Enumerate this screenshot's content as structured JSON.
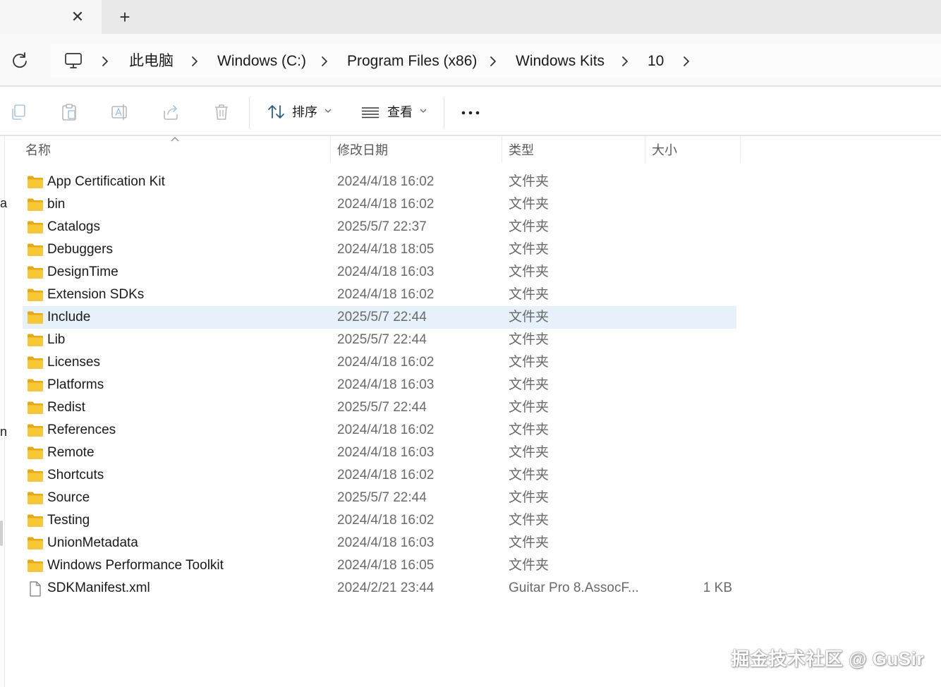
{
  "breadcrumb": [
    "此电脑",
    "Windows (C:)",
    "Program Files (x86)",
    "Windows Kits",
    "10"
  ],
  "toolbar": {
    "sort_label": "排序",
    "view_label": "查看"
  },
  "columns": {
    "name": "名称",
    "date": "修改日期",
    "type": "类型",
    "size": "大小"
  },
  "nav_fragments": [
    "a",
    "n"
  ],
  "rows": [
    {
      "name": "App Certification Kit",
      "date": "2024/4/18 16:02",
      "type": "文件夹",
      "size": "",
      "kind": "folder"
    },
    {
      "name": "bin",
      "date": "2024/4/18 16:02",
      "type": "文件夹",
      "size": "",
      "kind": "folder"
    },
    {
      "name": "Catalogs",
      "date": "2025/5/7 22:37",
      "type": "文件夹",
      "size": "",
      "kind": "folder"
    },
    {
      "name": "Debuggers",
      "date": "2024/4/18 18:05",
      "type": "文件夹",
      "size": "",
      "kind": "folder"
    },
    {
      "name": "DesignTime",
      "date": "2024/4/18 16:03",
      "type": "文件夹",
      "size": "",
      "kind": "folder"
    },
    {
      "name": "Extension SDKs",
      "date": "2024/4/18 16:02",
      "type": "文件夹",
      "size": "",
      "kind": "folder"
    },
    {
      "name": "Include",
      "date": "2025/5/7 22:44",
      "type": "文件夹",
      "size": "",
      "kind": "folder",
      "selected": true
    },
    {
      "name": "Lib",
      "date": "2025/5/7 22:44",
      "type": "文件夹",
      "size": "",
      "kind": "folder"
    },
    {
      "name": "Licenses",
      "date": "2024/4/18 16:02",
      "type": "文件夹",
      "size": "",
      "kind": "folder"
    },
    {
      "name": "Platforms",
      "date": "2024/4/18 16:03",
      "type": "文件夹",
      "size": "",
      "kind": "folder"
    },
    {
      "name": "Redist",
      "date": "2025/5/7 22:44",
      "type": "文件夹",
      "size": "",
      "kind": "folder"
    },
    {
      "name": "References",
      "date": "2024/4/18 16:02",
      "type": "文件夹",
      "size": "",
      "kind": "folder"
    },
    {
      "name": "Remote",
      "date": "2024/4/18 16:03",
      "type": "文件夹",
      "size": "",
      "kind": "folder"
    },
    {
      "name": "Shortcuts",
      "date": "2024/4/18 16:02",
      "type": "文件夹",
      "size": "",
      "kind": "folder"
    },
    {
      "name": "Source",
      "date": "2025/5/7 22:44",
      "type": "文件夹",
      "size": "",
      "kind": "folder"
    },
    {
      "name": "Testing",
      "date": "2024/4/18 16:02",
      "type": "文件夹",
      "size": "",
      "kind": "folder"
    },
    {
      "name": "UnionMetadata",
      "date": "2024/4/18 16:03",
      "type": "文件夹",
      "size": "",
      "kind": "folder"
    },
    {
      "name": "Windows Performance Toolkit",
      "date": "2024/4/18 16:05",
      "type": "文件夹",
      "size": "",
      "kind": "folder"
    },
    {
      "name": "SDKManifest.xml",
      "date": "2024/2/21 23:44",
      "type": "Guitar Pro 8.AssocF...",
      "size": "1 KB",
      "kind": "file"
    }
  ],
  "watermark": "掘金技术社区 @ GuSir",
  "colors": {
    "selected_row": "#e6f1fb",
    "folder": "#f8c737",
    "folder_dark": "#e7aa16"
  }
}
